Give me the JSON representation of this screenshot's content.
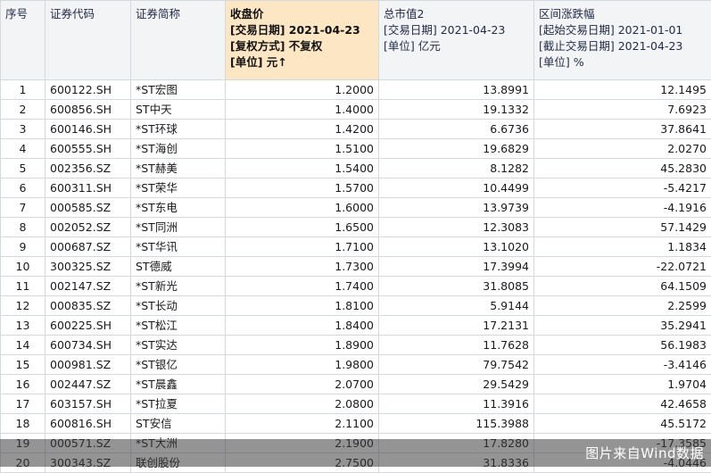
{
  "headers": {
    "h0": [
      "序号"
    ],
    "h1": [
      "证券代码"
    ],
    "h2": [
      "证券简称"
    ],
    "h3": [
      "收盘价",
      "[交易日期] 2021-04-23",
      "[复权方式] 不复权",
      "[单位] 元↑"
    ],
    "h4": [
      "总市值2",
      "[交易日期] 2021-04-23",
      "[单位] 亿元"
    ],
    "h5": [
      "区间涨跌幅",
      "[起始交易日期] 2021-01-01",
      "[截止交易日期] 2021-04-23",
      "[单位] %"
    ]
  },
  "rows": [
    [
      "1",
      "600122.SH",
      "*ST宏图",
      "1.2000",
      "13.8991",
      "12.1495"
    ],
    [
      "2",
      "600856.SH",
      "ST中天",
      "1.4000",
      "19.1332",
      "7.6923"
    ],
    [
      "3",
      "600146.SH",
      "*ST环球",
      "1.4200",
      "6.6736",
      "37.8641"
    ],
    [
      "4",
      "600555.SH",
      "*ST海创",
      "1.5100",
      "19.6829",
      "2.0270"
    ],
    [
      "5",
      "002356.SZ",
      "*ST赫美",
      "1.5400",
      "8.1282",
      "45.2830"
    ],
    [
      "6",
      "600311.SH",
      "*ST荣华",
      "1.5700",
      "10.4499",
      "-5.4217"
    ],
    [
      "7",
      "000585.SZ",
      "*ST东电",
      "1.6000",
      "13.9739",
      "-4.1916"
    ],
    [
      "8",
      "002052.SZ",
      "*ST同洲",
      "1.6500",
      "12.3083",
      "57.1429"
    ],
    [
      "9",
      "000687.SZ",
      "*ST华讯",
      "1.7100",
      "13.1020",
      "1.1834"
    ],
    [
      "10",
      "300325.SZ",
      "ST德威",
      "1.7300",
      "17.3994",
      "-22.0721"
    ],
    [
      "11",
      "002147.SZ",
      "*ST新光",
      "1.7400",
      "31.8085",
      "64.1509"
    ],
    [
      "12",
      "000835.SZ",
      "*ST长动",
      "1.8100",
      "5.9144",
      "2.2599"
    ],
    [
      "13",
      "600225.SH",
      "*ST松江",
      "1.8400",
      "17.2131",
      "35.2941"
    ],
    [
      "14",
      "600734.SH",
      "*ST实达",
      "1.8900",
      "11.7628",
      "56.1983"
    ],
    [
      "15",
      "000981.SZ",
      "*ST银亿",
      "1.9800",
      "79.7542",
      "-3.4146"
    ],
    [
      "16",
      "002447.SZ",
      "*ST晨鑫",
      "2.0700",
      "29.5429",
      "1.9704"
    ],
    [
      "17",
      "603157.SH",
      "*ST拉夏",
      "2.0800",
      "11.3916",
      "42.4658"
    ],
    [
      "18",
      "600816.SH",
      "ST安信",
      "2.1100",
      "115.3988",
      "45.5172"
    ],
    [
      "19",
      "000571.SZ",
      "*ST大洲",
      "2.1900",
      "17.8280",
      "-17.3585"
    ],
    [
      "20",
      "300343.SZ",
      "联创股份",
      "2.7500",
      "31.8336",
      "-4.0446"
    ]
  ],
  "watermark": "图片来自Wind数据"
}
